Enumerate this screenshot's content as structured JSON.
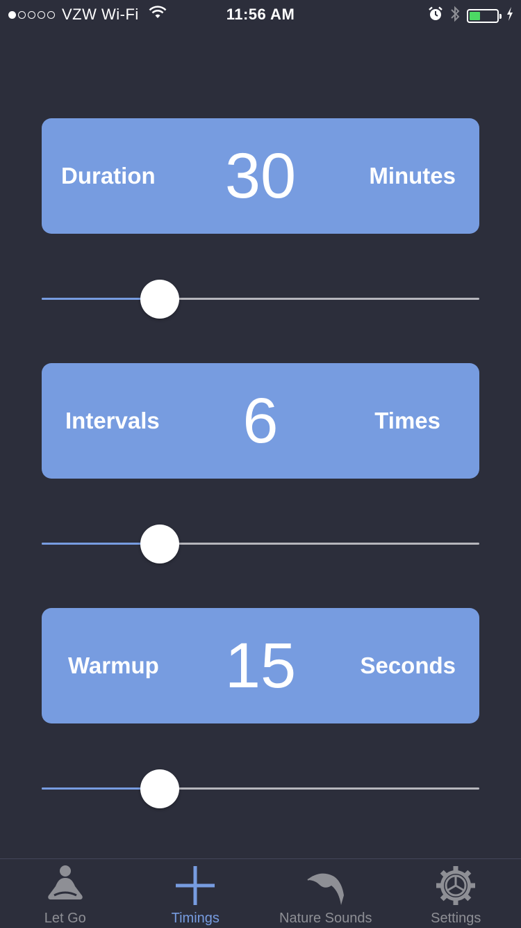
{
  "status_bar": {
    "carrier": "VZW Wi-Fi",
    "time": "11:56 AM",
    "signal_bars_filled": 1,
    "signal_bars_total": 5,
    "battery_level": 0.45,
    "battery_color": "#4cd964"
  },
  "cards": [
    {
      "label": "Duration",
      "value": "30",
      "unit": "Minutes",
      "slider_level": 0.27
    },
    {
      "label": "Intervals",
      "value": "6",
      "unit": "Times",
      "slider_level": 0.27
    },
    {
      "label": "Warmup",
      "value": "15",
      "unit": "Seconds",
      "slider_level": 0.27
    }
  ],
  "tab_bar": {
    "tabs": [
      {
        "label": "Let Go",
        "icon": "meditation-icon",
        "active": false
      },
      {
        "label": "Timings",
        "icon": "plus-icon",
        "active": true
      },
      {
        "label": "Nature Sounds",
        "icon": "bird-icon",
        "active": false
      },
      {
        "label": "Settings",
        "icon": "gear-icon",
        "active": false
      }
    ]
  },
  "colors": {
    "background": "#2c2e3b",
    "accent": "#779ce0",
    "track": "#b6b6bc",
    "inactive_tab": "#8e8f95"
  }
}
